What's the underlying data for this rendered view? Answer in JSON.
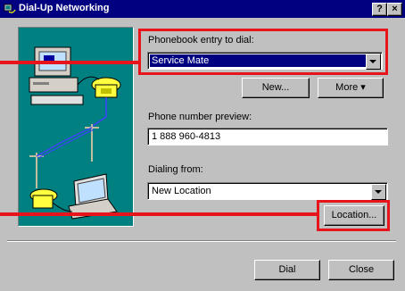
{
  "window": {
    "title": "Dial-Up Networking",
    "help_glyph": "?",
    "close_glyph": "×"
  },
  "form": {
    "phonebook_label": "Phonebook entry to dial:",
    "phonebook_value": "Service Mate",
    "new_button": "New...",
    "more_button": "More ▾",
    "phone_label": "Phone number preview:",
    "phone_value": "1 888 960-4813",
    "dialing_label": "Dialing from:",
    "dialing_value": "New Location",
    "location_button": "Location...",
    "dial_button": "Dial",
    "close_button": "Close"
  },
  "colors": {
    "highlight": "#e8141c",
    "titlebar": "#000080",
    "illustration_bg": "#008080"
  }
}
